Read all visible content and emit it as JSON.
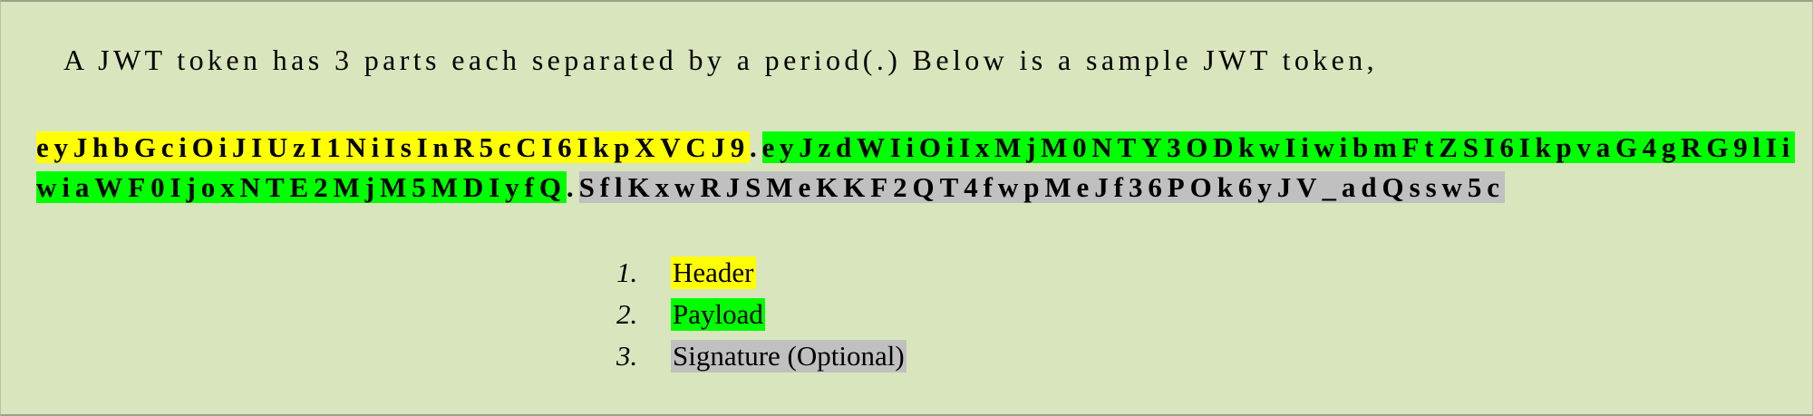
{
  "intro": "A JWT token has 3 parts each separated by a period(.) Below is a sample JWT token,",
  "token": {
    "header": "eyJhbGciOiJIUzI1NiIsInR5cCI6IkpXVCJ9",
    "dot1": ".",
    "payload_line1": "eyJzdWIiOiIxMjM0NTY3ODkwIiwibmFtZSI6IkpvaG4gRG9lIi",
    "payload_line2": "wiaWF0IjoxNTE2MjM5MDIyfQ",
    "dot2": ".",
    "signature": "SflKxwRJSMeKKF2QT4fwpMeJf36POk6yJV_adQssw5c"
  },
  "parts": [
    {
      "num": "1.",
      "label": "Header",
      "color": "#ffff00"
    },
    {
      "num": "2.",
      "label": "Payload",
      "color": "#00ff00"
    },
    {
      "num": "3.",
      "label": "Signature (Optional)",
      "color": "#c0c0c0"
    }
  ]
}
